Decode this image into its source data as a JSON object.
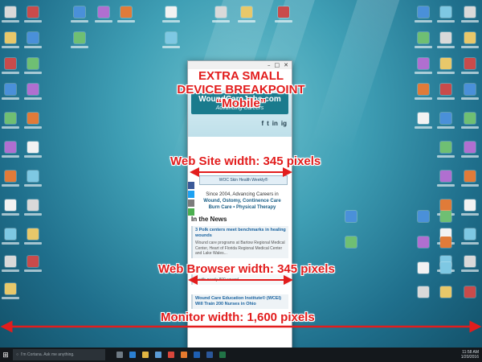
{
  "colors": {
    "annotation_red": "#e21d1d",
    "taskbar": "#14181c",
    "site_accent": "#1a7b8d",
    "link_blue": "#1a63a0"
  },
  "captions": {
    "title_line1": "EXTRA SMALL",
    "title_line2": "DEVICE BREAKPOINT",
    "title_line3": "“Mobile”",
    "website_width": "Web Site width:  345 pixels",
    "browser_width": "Web Browser width:  345 pixels",
    "monitor_width": "Monitor width: 1,600 pixels"
  },
  "browser": {
    "window_controls": [
      "–",
      "□",
      "✕"
    ],
    "logo_text": "WoundCareJobs.com",
    "logo_subtitle": "Advancing Careers",
    "social_icons": [
      "f",
      "t",
      "in",
      "ig"
    ],
    "share_icons": [
      "facebook-share-icon",
      "twitter-share-icon",
      "email-share-icon",
      "share-icon"
    ],
    "newsletter_label": "WOC Skin Health Weekly®",
    "tagline_line1": "Since 2004, Advancing Careers in",
    "tagline_line2": "Wound, Ostomy, Continence Care",
    "tagline_line3": "Burn Care • Physical Therapy",
    "news_heading": "In the News",
    "news": [
      {
        "headline": "3 Polk centers meet benchmarks in healing wounds",
        "body": "Wound care programs at Bartow Regional Medical Center, Heart of Florida Regional Medical Center and Lake Wales..."
      },
      {
        "headline": "",
        "body": "...with nearly 800 wound..."
      },
      {
        "headline": "Wound Care Education Institute® (WCEI) Will Train 200 Nurses in Ohio",
        "body": ""
      }
    ]
  },
  "taskbar": {
    "search_placeholder": "I'm Cortana. Ask me anything.",
    "clock_time": "11:58 AM",
    "clock_date": "1/20/2016"
  }
}
